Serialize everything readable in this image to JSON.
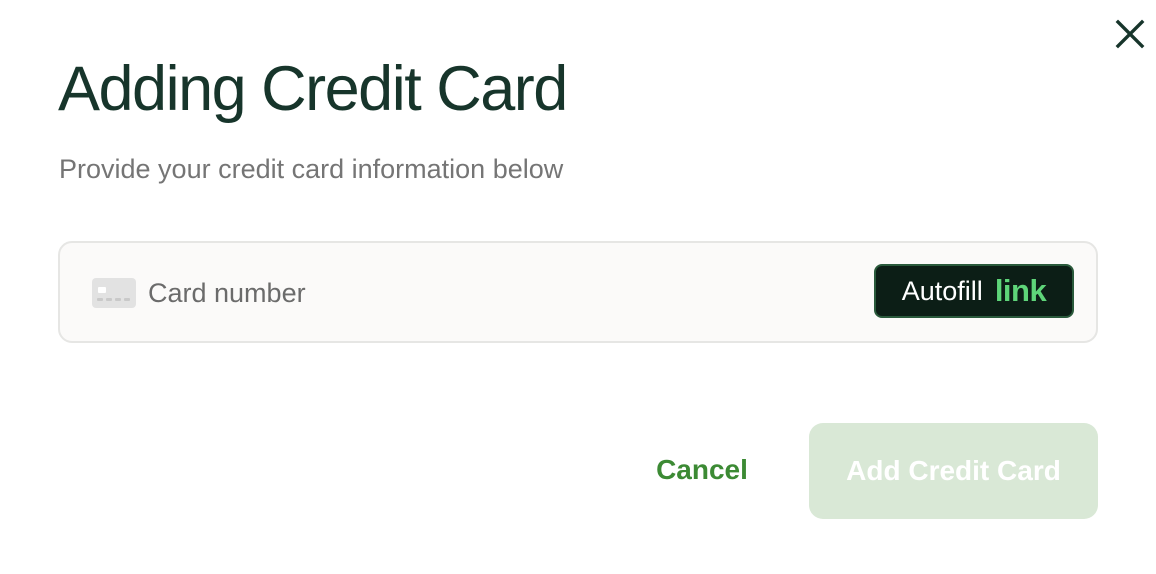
{
  "dialog": {
    "title": "Adding Credit Card",
    "subtitle": "Provide your credit card information below",
    "close_icon": "close-icon"
  },
  "card_field": {
    "icon": "credit-card-icon",
    "placeholder": "Card number",
    "value": "",
    "autofill": {
      "label": "Autofill",
      "brand": "link"
    }
  },
  "actions": {
    "cancel_label": "Cancel",
    "submit_label": "Add Credit Card",
    "submit_enabled": false
  },
  "colors": {
    "title": "#17352b",
    "accent_green": "#3c8a34",
    "link_green": "#5ed579",
    "autofill_bg": "#0c1e16",
    "disabled_button_bg": "#d9e8d6"
  }
}
